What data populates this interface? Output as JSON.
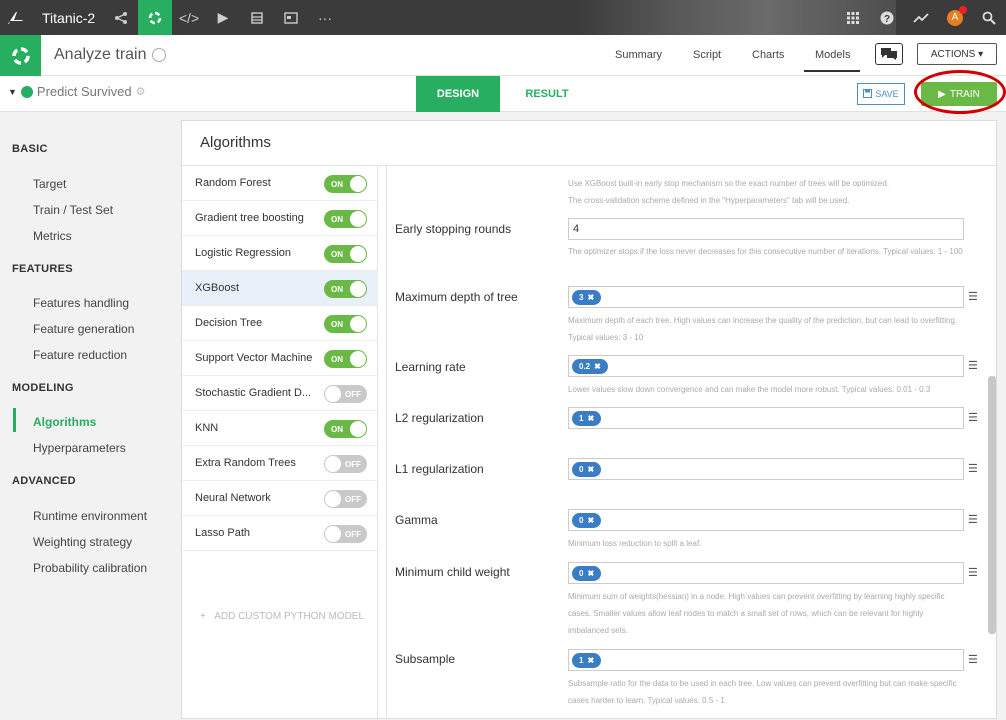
{
  "topbar": {
    "project": "Titanic-2",
    "avatar_initial": "A"
  },
  "header2": {
    "title": "Analyze train",
    "tabs": [
      "Summary",
      "Script",
      "Charts",
      "Models"
    ],
    "actions_label": "ACTIONS ▾"
  },
  "header3": {
    "predict_label": "Predict Survived",
    "design_label": "DESIGN",
    "result_label": "RESULT",
    "save_label": "SAVE",
    "train_label": "TRAIN"
  },
  "sidebar": {
    "sections": [
      {
        "title": "BASIC",
        "items": [
          "Target",
          "Train / Test Set",
          "Metrics"
        ]
      },
      {
        "title": "FEATURES",
        "items": [
          "Features handling",
          "Feature generation",
          "Feature reduction"
        ]
      },
      {
        "title": "MODELING",
        "items": [
          "Algorithms",
          "Hyperparameters"
        ]
      },
      {
        "title": "ADVANCED",
        "items": [
          "Runtime environment",
          "Weighting strategy",
          "Probability calibration"
        ]
      }
    ],
    "active_item": "Algorithms"
  },
  "panel": {
    "title": "Algorithms",
    "algorithms": [
      {
        "name": "Random Forest",
        "state": "ON"
      },
      {
        "name": "Gradient tree boosting",
        "state": "ON"
      },
      {
        "name": "Logistic Regression",
        "state": "ON"
      },
      {
        "name": "XGBoost",
        "state": "ON"
      },
      {
        "name": "Decision Tree",
        "state": "ON"
      },
      {
        "name": "Support Vector Machine",
        "state": "ON"
      },
      {
        "name": "Stochastic Gradient D...",
        "state": "OFF"
      },
      {
        "name": "KNN",
        "state": "ON"
      },
      {
        "name": "Extra Random Trees",
        "state": "OFF"
      },
      {
        "name": "Neural Network",
        "state": "OFF"
      },
      {
        "name": "Lasso Path",
        "state": "OFF"
      }
    ],
    "selected_algorithm": "XGBoost",
    "add_custom": "ADD CUSTOM PYTHON MODEL"
  },
  "form": {
    "early_stop_help_1": "Use XGBoost built-in early stop mechanism so the exact number of trees will be optimized.",
    "early_stop_help_2": "The cross-validation scheme defined in the \"Hyperparameters\" tab will be used.",
    "rounds_label": "Early stopping rounds",
    "rounds_value": "4",
    "rounds_help": "The optimizer stops if the loss never decreases for this consecutive number of iterations. Typical values: 1 - 100",
    "depth_label": "Maximum depth of tree",
    "depth_value": "3",
    "depth_help": "Maximum depth of each tree. High values can increase the quality of the prediction, but can lead to overfitting. Typical values: 3 - 10",
    "lr_label": "Learning rate",
    "lr_value": "0.2",
    "lr_help": "Lower values slow down convergence and can make the model more robust. Typical values: 0.01 - 0.3",
    "l2_label": "L2 regularization",
    "l2_value": "1",
    "l1_label": "L1 regularization",
    "l1_value": "0",
    "gamma_label": "Gamma",
    "gamma_value": "0",
    "gamma_help": "Minimum loss reduction to split a leaf.",
    "mcw_label": "Minimum child weight",
    "mcw_value": "0",
    "mcw_help": "Minimum sum of weights(hessian) in a node. High values can prevent overfitting by learning highly specific cases. Smaller values allow leaf nodes to match a small set of rows, which can be relevant for highly imbalanced sets.",
    "sub_label": "Subsample",
    "sub_value": "1",
    "sub_help": "Subsample ratio for the data to be used in each tree. Low values can prevent overfitting but can make specific cases harder to learn. Typical values: 0.5 - 1"
  },
  "colors": {
    "green": "#27ae60",
    "toggle_on": "#6ab946",
    "chip": "#3a7dc4",
    "highlight": "#d10000"
  }
}
